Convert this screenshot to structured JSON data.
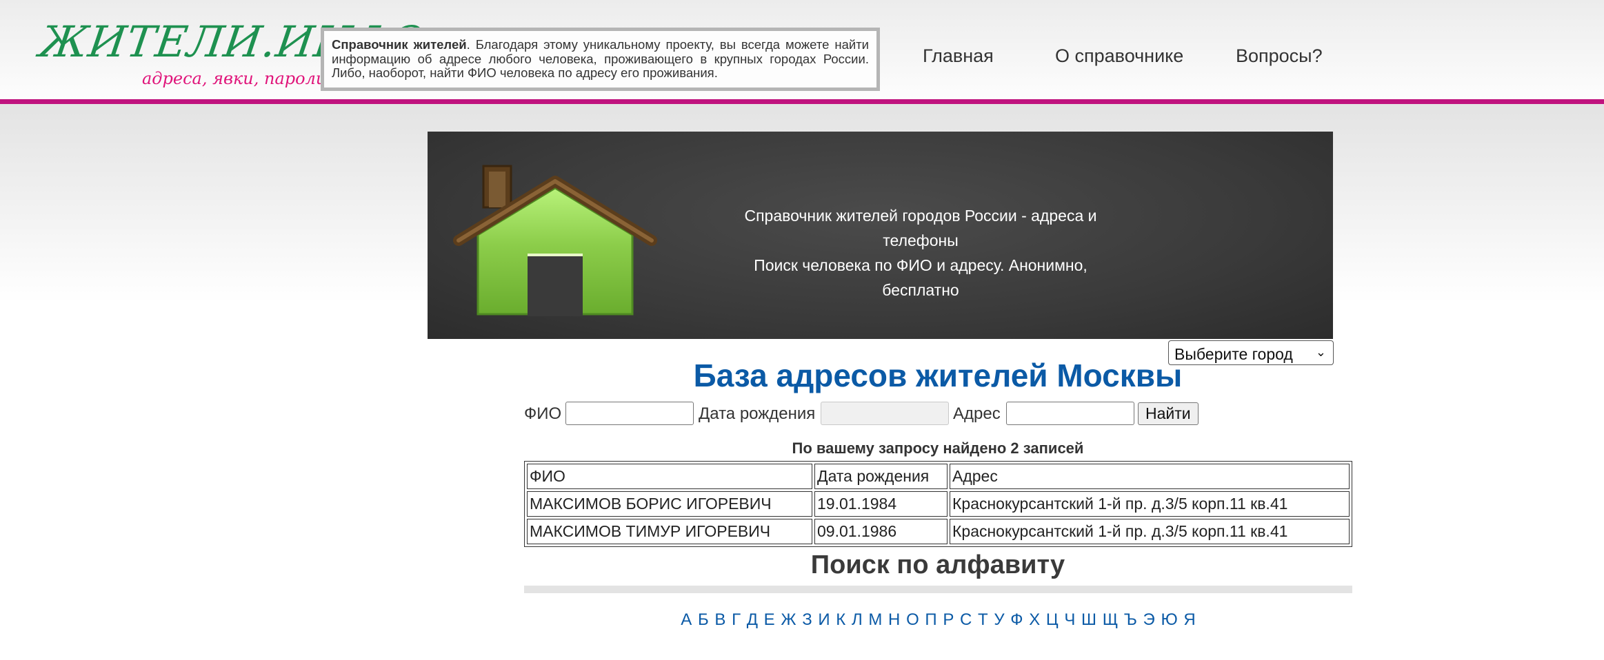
{
  "logo": {
    "main": "ЖИТЕЛИ.ИНФО",
    "tagline": "адреса, явки, пароли"
  },
  "intro": {
    "bold": "Справочник жителей",
    "text": ". Благодаря этому уникальному проекту, вы всегда можете найти информацию об адресе любого человека, проживающего в крупных городах России. Либо, наоборот, найти ФИО человека по адресу его проживания."
  },
  "nav": {
    "home": "Главная",
    "about": "О справочнике",
    "faq": "Вопросы?"
  },
  "banner": {
    "line1": "Справочник жителей городов России - адреса и телефоны",
    "line2": "Поиск человека по ФИО и адресу. Анонимно, бесплатно"
  },
  "city_select": {
    "value": "Выберите город"
  },
  "page_title": "База адресов жителей Москвы",
  "search": {
    "fio_label": "ФИО",
    "fio_value": "",
    "dob_label": "Дата рождения",
    "dob_value": "",
    "address_label": "Адрес",
    "address_value": "",
    "submit": "Найти"
  },
  "results": {
    "summary": "По вашему запросу найдено 2 записей",
    "headers": [
      "ФИО",
      "Дата рождения",
      "Адрес"
    ],
    "rows": [
      [
        "МАКСИМОВ БОРИС ИГОРЕВИЧ",
        "19.01.1984",
        "Краснокурсантский 1-й пр. д.3/5 корп.11 кв.41"
      ],
      [
        "МАКСИМОВ ТИМУР ИГОРЕВИЧ",
        "09.01.1986",
        "Краснокурсантский 1-й пр. д.3/5 корп.11 кв.41"
      ]
    ]
  },
  "alphabet": {
    "title": "Поиск по алфавиту",
    "letters": [
      "А",
      "Б",
      "В",
      "Г",
      "Д",
      "Е",
      "Ж",
      "З",
      "И",
      "К",
      "Л",
      "М",
      "Н",
      "О",
      "П",
      "Р",
      "С",
      "Т",
      "У",
      "Ф",
      "Х",
      "Ц",
      "Ч",
      "Ш",
      "Щ",
      "Ъ",
      "Э",
      "Ю",
      "Я"
    ]
  },
  "colors": {
    "accent_magenta": "#c0137e",
    "title_blue": "#0b5aa6",
    "logo_green": "#1e9150",
    "logo_pink": "#e0147a"
  },
  "icons": {
    "banner": "house-icon",
    "select": "chevron-down-icon"
  }
}
